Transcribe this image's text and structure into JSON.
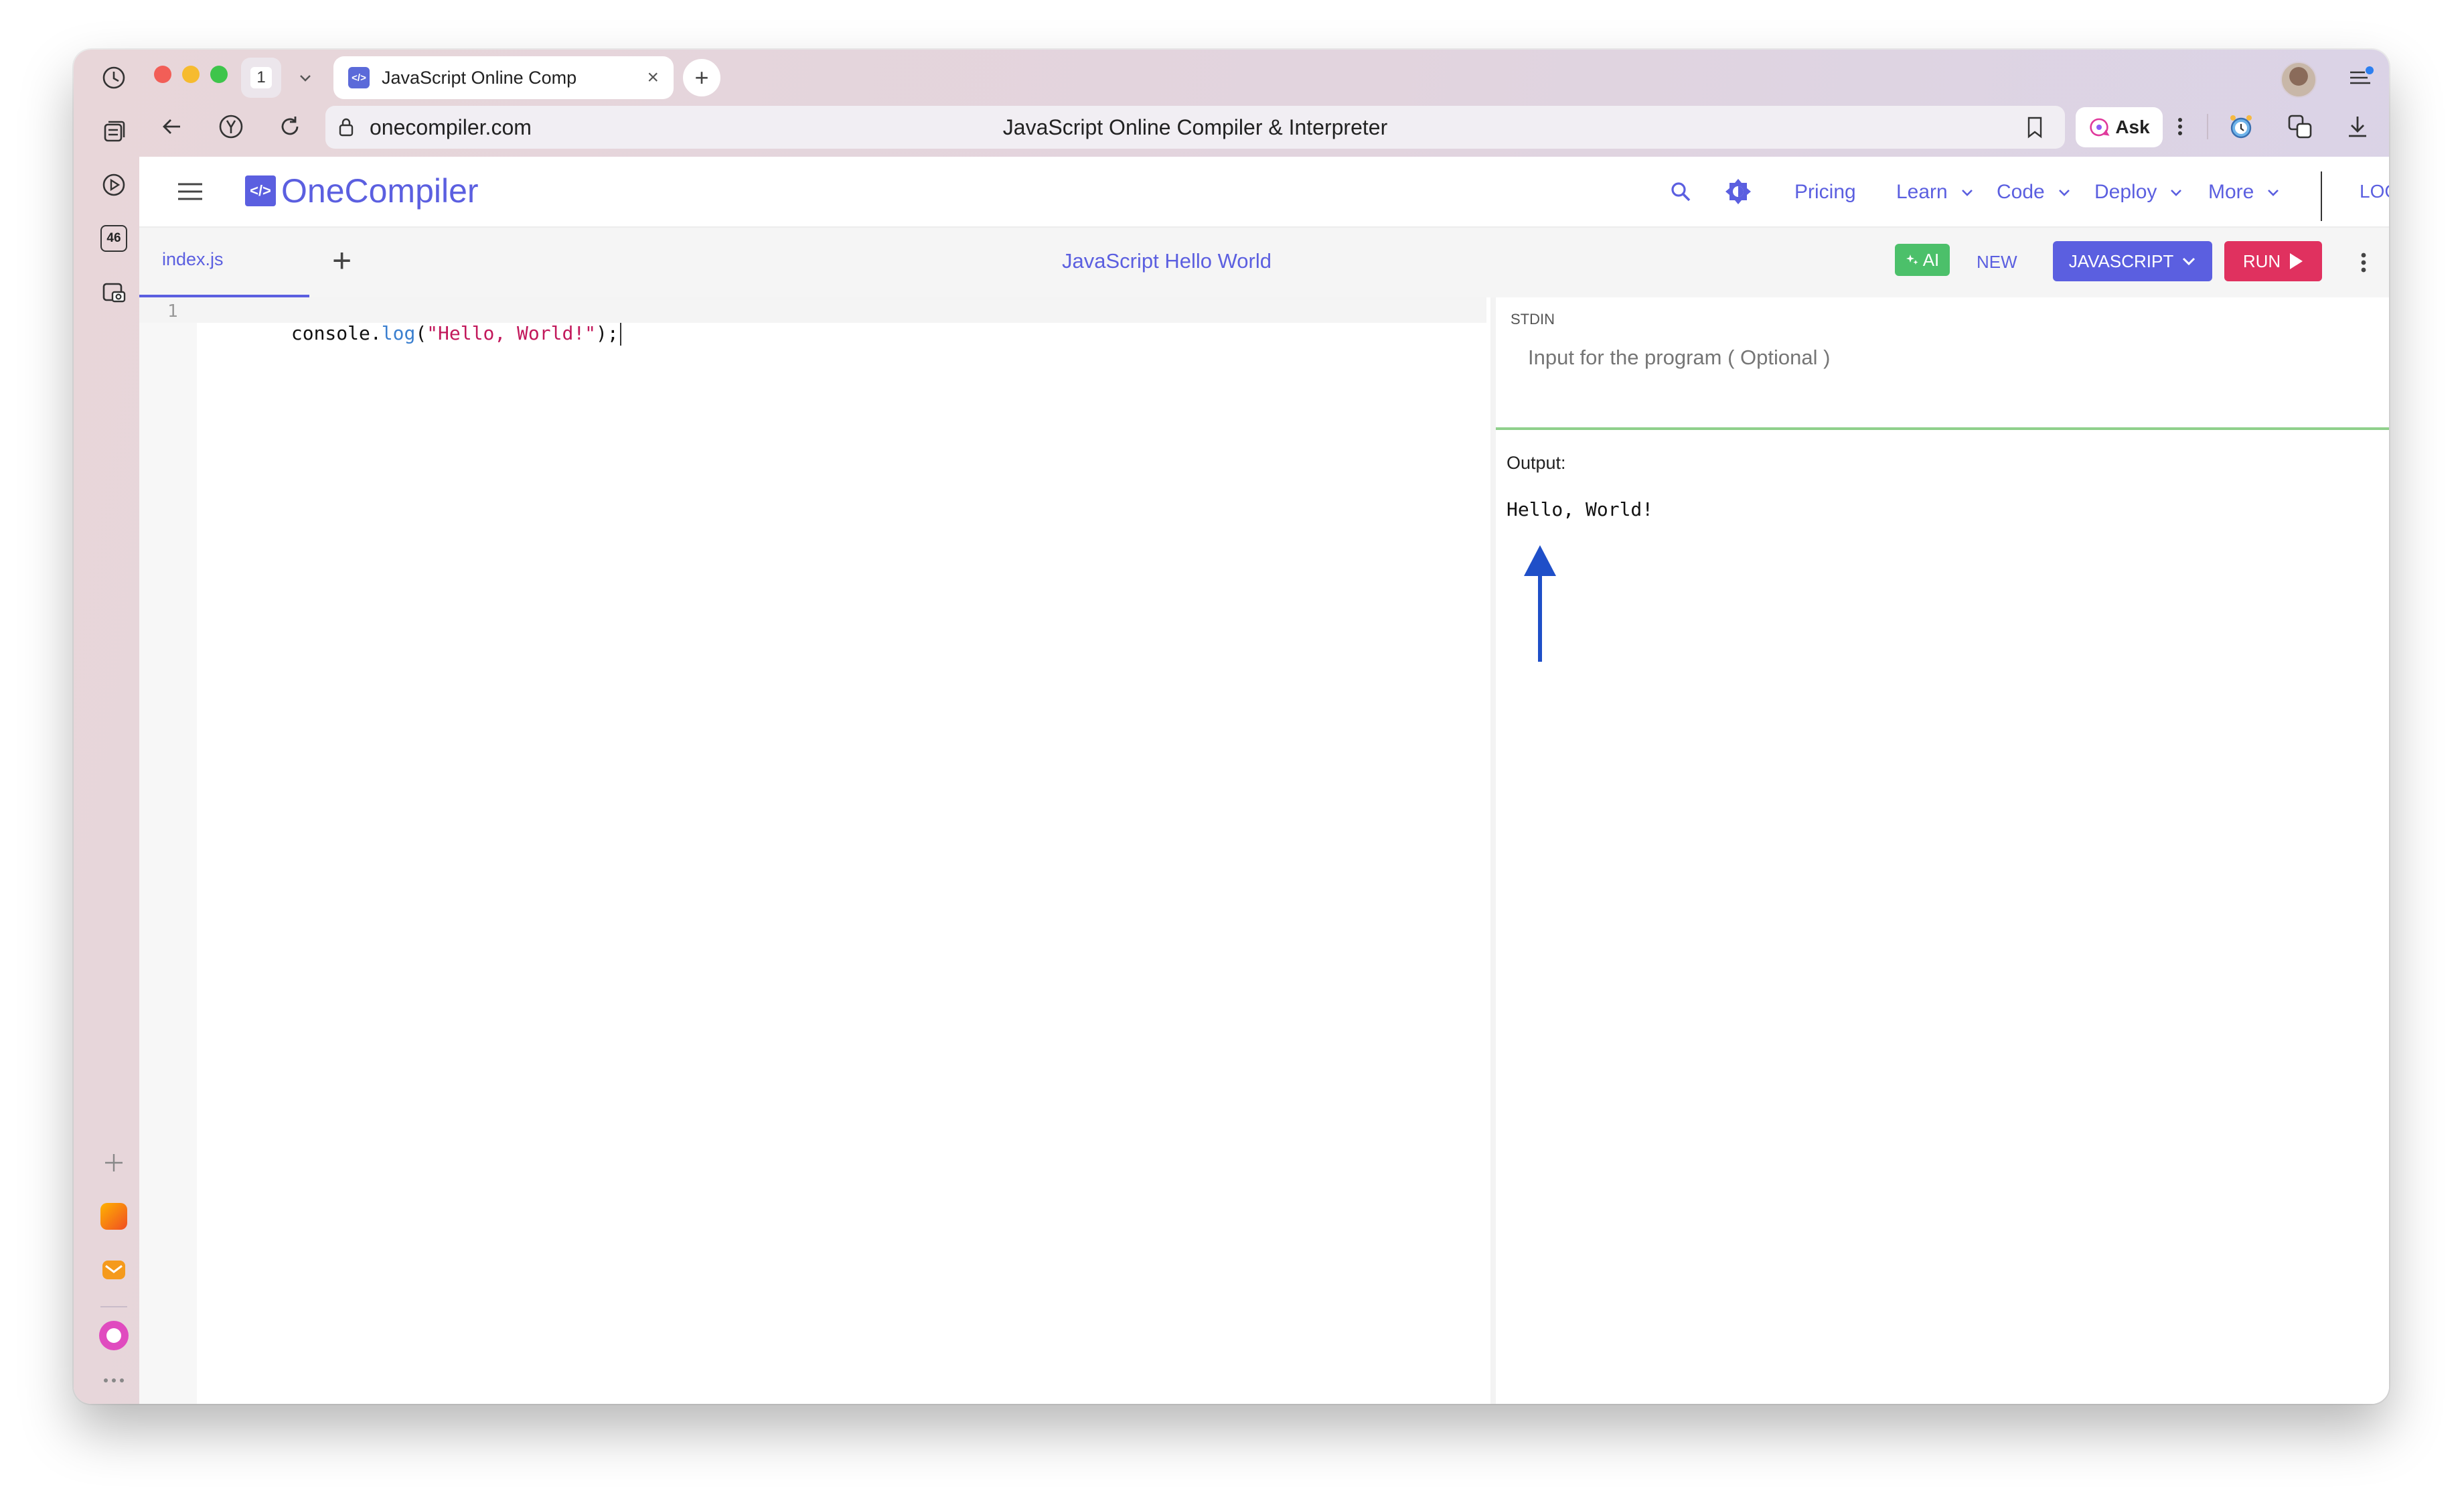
{
  "browser": {
    "tab_count": "1",
    "tab_title": "JavaScript Online Comp",
    "tab_close": "×",
    "new_tab": "+",
    "url": "onecompiler.com",
    "page_title": "JavaScript Online Compiler & Interpreter",
    "ask_label": "Ask",
    "sidebar_badge": "46"
  },
  "site": {
    "logo_mark": "</>",
    "logo_text": "OneCompiler",
    "nav": {
      "pricing": "Pricing",
      "learn": "Learn",
      "code": "Code",
      "deploy": "Deploy",
      "more": "More",
      "login": "LOGIN"
    }
  },
  "toolbar": {
    "file_tab": "index.js",
    "add_file": "+",
    "title": "JavaScript Hello World",
    "ai_label": "AI",
    "new_label": "NEW",
    "language": "JAVASCRIPT",
    "run_label": "RUN"
  },
  "editor": {
    "line_number": "1",
    "code": {
      "obj": "console",
      "dot": ".",
      "method": "log",
      "open": "(",
      "string": "\"Hello, World!\"",
      "close": ");"
    }
  },
  "stdin": {
    "label": "STDIN",
    "placeholder": "Input for the program ( Optional )"
  },
  "output": {
    "label": "Output:",
    "text": "Hello, World!"
  },
  "colors": {
    "brand": "#5b5fe0",
    "run": "#e0315f",
    "language": "#5b5fe0",
    "ai": "#4cc06a",
    "arrow": "#1f4fc8",
    "stdin_divider": "#8fd08c"
  }
}
